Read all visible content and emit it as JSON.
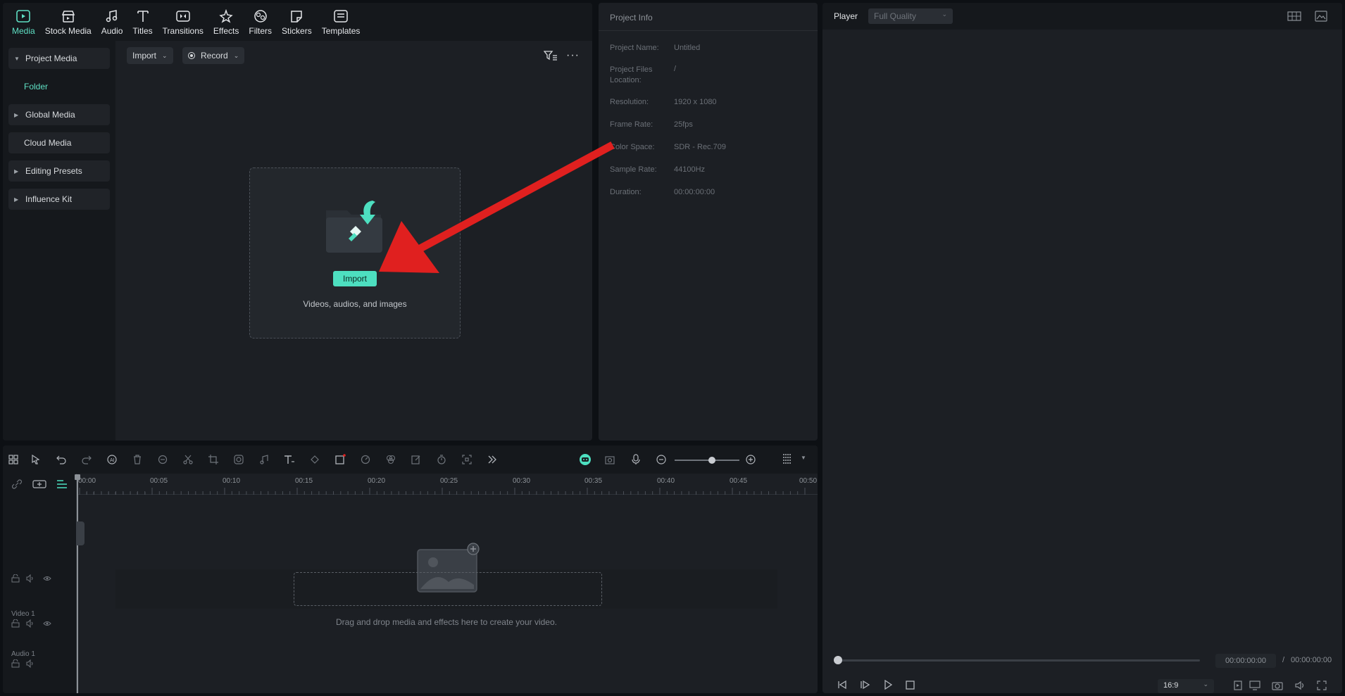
{
  "toolbar": {
    "tabs": [
      {
        "label": "Media",
        "icon": "media-icon"
      },
      {
        "label": "Stock Media",
        "icon": "stock-media-icon"
      },
      {
        "label": "Audio",
        "icon": "audio-icon"
      },
      {
        "label": "Titles",
        "icon": "titles-icon"
      },
      {
        "label": "Transitions",
        "icon": "transitions-icon"
      },
      {
        "label": "Effects",
        "icon": "effects-icon"
      },
      {
        "label": "Filters",
        "icon": "filters-icon"
      },
      {
        "label": "Stickers",
        "icon": "stickers-icon"
      },
      {
        "label": "Templates",
        "icon": "templates-icon"
      }
    ]
  },
  "sidebar": {
    "project_media": "Project Media",
    "folder": "Folder",
    "global_media": "Global Media",
    "cloud_media": "Cloud Media",
    "editing_presets": "Editing Presets",
    "influence_kit": "Influence Kit"
  },
  "media": {
    "import_label": "Import",
    "record_label": "Record",
    "drop_import_label": "Import",
    "drop_hint": "Videos, audios, and images"
  },
  "project_info": {
    "title": "Project Info",
    "rows": [
      {
        "label": "Project Name:",
        "value": "Untitled"
      },
      {
        "label": "Project Files Location:",
        "value": "/"
      },
      {
        "label": "Resolution:",
        "value": "1920 x 1080"
      },
      {
        "label": "Frame Rate:",
        "value": "25fps"
      },
      {
        "label": "Color Space:",
        "value": "SDR - Rec.709"
      },
      {
        "label": "Sample Rate:",
        "value": "44100Hz"
      },
      {
        "label": "Duration:",
        "value": "00:00:00:00"
      }
    ]
  },
  "player": {
    "title": "Player",
    "quality": "Full Quality",
    "current_time": "00:00:00:00",
    "separator": "/",
    "total_time": "00:00:00:00",
    "aspect": "16:9"
  },
  "timeline": {
    "ruler": [
      "00:00",
      "00:05",
      "00:10",
      "00:15",
      "00:20",
      "00:25",
      "00:30",
      "00:35",
      "00:40",
      "00:45",
      "00:50"
    ],
    "video_track": "Video 1",
    "audio_track": "Audio 1",
    "drop_hint": "Drag and drop media and effects here to create your video."
  },
  "colors": {
    "accent": "#4ddfc0",
    "annotation_arrow": "#e0201f"
  }
}
